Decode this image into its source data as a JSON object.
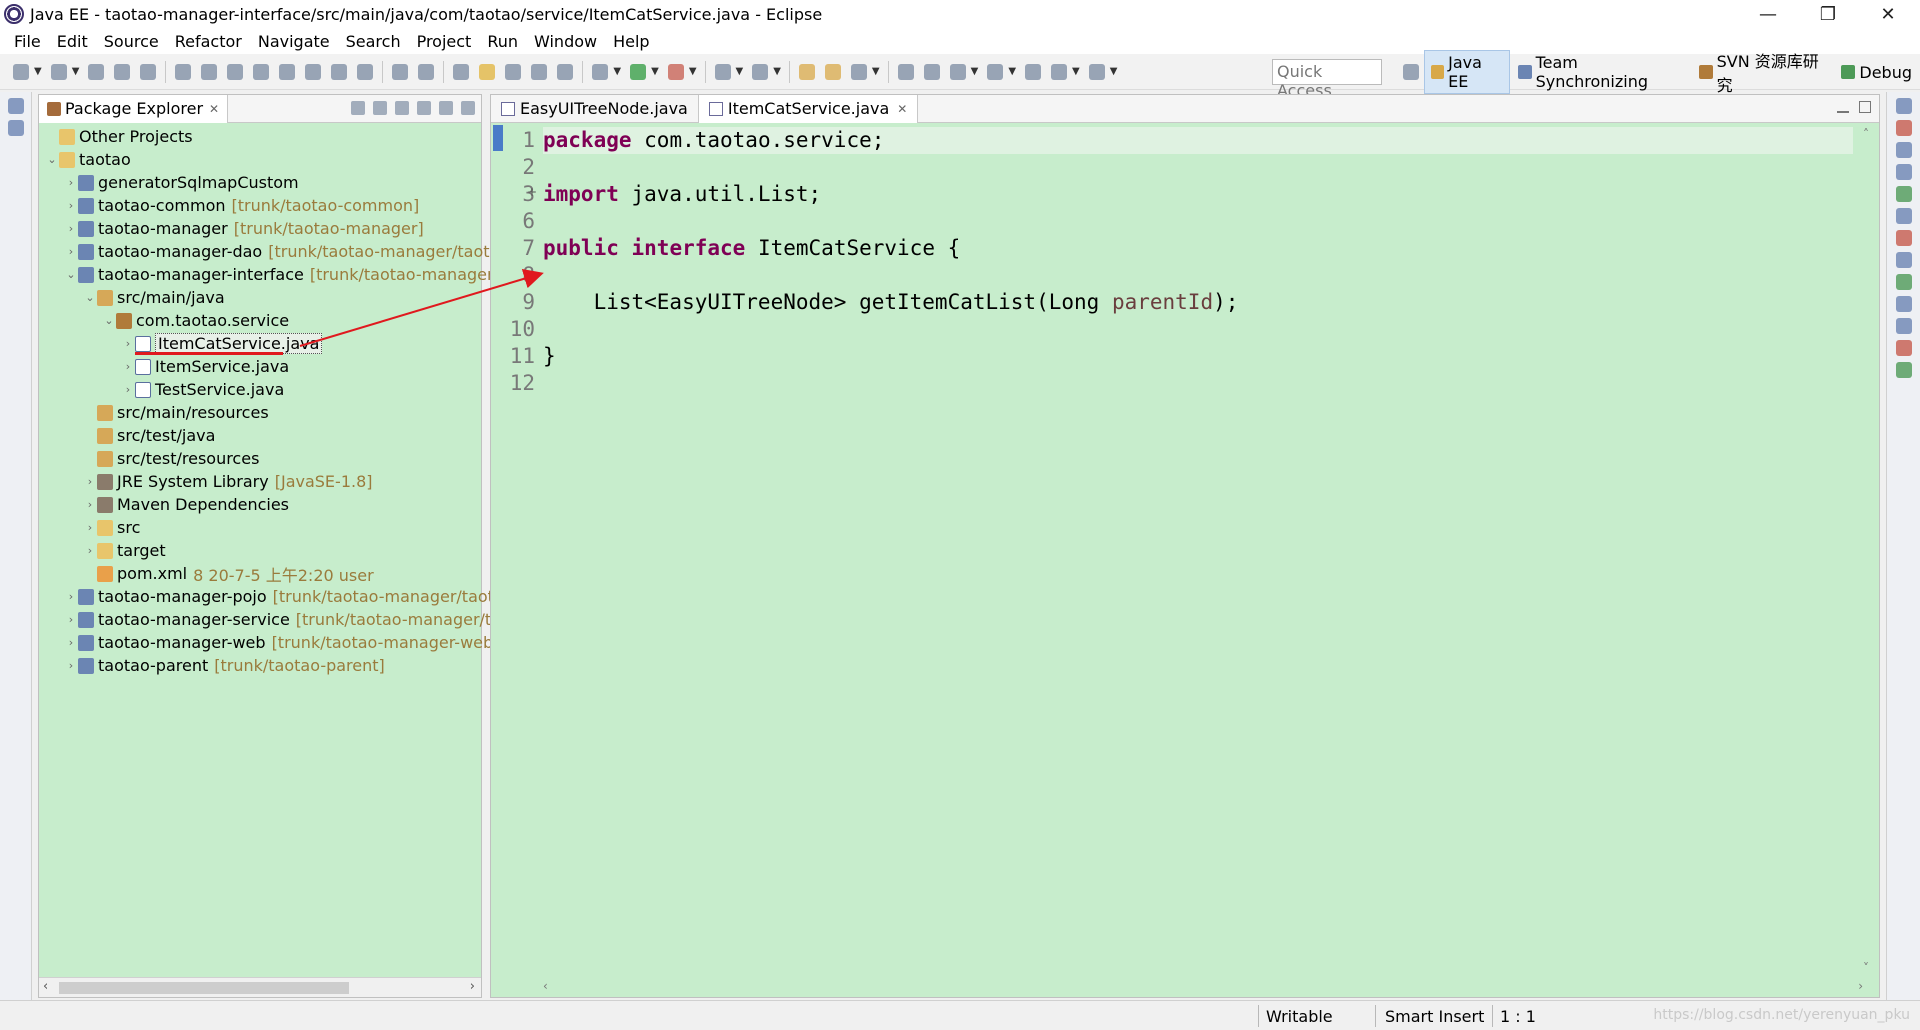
{
  "window": {
    "title": "Java EE - taotao-manager-interface/src/main/java/com/taotao/service/ItemCatService.java - Eclipse",
    "controls": [
      "—",
      "❐",
      "✕"
    ]
  },
  "menu": [
    "File",
    "Edit",
    "Source",
    "Refactor",
    "Navigate",
    "Search",
    "Project",
    "Run",
    "Window",
    "Help"
  ],
  "toolbar": {
    "quick_access": "Quick Access",
    "perspectives": [
      {
        "label": "Java EE",
        "active": true
      },
      {
        "label": "Team Synchronizing",
        "active": false
      },
      {
        "label": "SVN 资源库研究",
        "active": false
      },
      {
        "label": "Debug",
        "active": false
      }
    ]
  },
  "package_explorer": {
    "title": "Package Explorer",
    "close": "✕",
    "tree": [
      {
        "label": "Other Projects",
        "deco": "",
        "level": 0,
        "chev": "",
        "icon": "folder"
      },
      {
        "label": "taotao",
        "deco": "",
        "level": 0,
        "chev": "⌄",
        "icon": "folder"
      },
      {
        "label": "generatorSqlmapCustom",
        "deco": "",
        "level": 1,
        "chev": "›",
        "icon": "project"
      },
      {
        "label": "taotao-common",
        "deco": "[trunk/taotao-common]",
        "level": 1,
        "chev": "›",
        "icon": "project"
      },
      {
        "label": "taotao-manager",
        "deco": "[trunk/taotao-manager]",
        "level": 1,
        "chev": "›",
        "icon": "project"
      },
      {
        "label": "taotao-manager-dao",
        "deco": "[trunk/taotao-manager/taotao-",
        "level": 1,
        "chev": "›",
        "icon": "project"
      },
      {
        "label": "taotao-manager-interface",
        "deco": "[trunk/taotao-manager/ta",
        "level": 1,
        "chev": "⌄",
        "icon": "project"
      },
      {
        "label": "src/main/java",
        "deco": "",
        "level": 2,
        "chev": "⌄",
        "icon": "src"
      },
      {
        "label": "com.taotao.service",
        "deco": "",
        "level": 3,
        "chev": "⌄",
        "icon": "pkg"
      },
      {
        "label": "ItemCatService.java",
        "deco": "",
        "level": 4,
        "chev": "›",
        "icon": "java",
        "selected": true
      },
      {
        "label": "ItemService.java",
        "deco": "",
        "level": 4,
        "chev": "›",
        "icon": "java"
      },
      {
        "label": "TestService.java",
        "deco": "",
        "level": 4,
        "chev": "›",
        "icon": "java"
      },
      {
        "label": "src/main/resources",
        "deco": "",
        "level": 2,
        "chev": "",
        "icon": "src"
      },
      {
        "label": "src/test/java",
        "deco": "",
        "level": 2,
        "chev": "",
        "icon": "src"
      },
      {
        "label": "src/test/resources",
        "deco": "",
        "level": 2,
        "chev": "",
        "icon": "src"
      },
      {
        "label": "JRE System Library",
        "deco": "[JavaSE-1.8]",
        "level": 2,
        "chev": "›",
        "icon": "lib"
      },
      {
        "label": "Maven Dependencies",
        "deco": "",
        "level": 2,
        "chev": "›",
        "icon": "lib"
      },
      {
        "label": "src",
        "deco": "",
        "level": 2,
        "chev": "›",
        "icon": "folder"
      },
      {
        "label": "target",
        "deco": "",
        "level": 2,
        "chev": "›",
        "icon": "folder"
      },
      {
        "label": "pom.xml",
        "deco": "8  20-7-5 上午2:20  user",
        "level": 2,
        "chev": "",
        "icon": "xml"
      },
      {
        "label": "taotao-manager-pojo",
        "deco": "[trunk/taotao-manager/taotao",
        "level": 1,
        "chev": "›",
        "icon": "project"
      },
      {
        "label": "taotao-manager-service",
        "deco": "[trunk/taotao-manager/taot",
        "level": 1,
        "chev": "›",
        "icon": "project"
      },
      {
        "label": "taotao-manager-web",
        "deco": "[trunk/taotao-manager-web]",
        "level": 1,
        "chev": "›",
        "icon": "project"
      },
      {
        "label": "taotao-parent",
        "deco": "[trunk/taotao-parent]",
        "level": 1,
        "chev": "›",
        "icon": "project"
      }
    ]
  },
  "editor": {
    "tabs": [
      {
        "label": "EasyUITreeNode.java",
        "active": false
      },
      {
        "label": "ItemCatService.java",
        "active": true
      }
    ],
    "line_numbers": [
      "1",
      "2",
      "3",
      "6",
      "7",
      "8",
      "9",
      "10",
      "11",
      "12"
    ],
    "lines": [
      [
        {
          "t": "package",
          "k": "kw"
        },
        {
          "t": " com.taotao.service;",
          "k": ""
        }
      ],
      [],
      [
        {
          "t": "import",
          "k": "kw"
        },
        {
          "t": " java.util.List;",
          "k": ""
        }
      ],
      [],
      [
        {
          "t": "public",
          "k": "kw"
        },
        {
          "t": " ",
          "k": ""
        },
        {
          "t": "interface",
          "k": "kw"
        },
        {
          "t": " ItemCatService {",
          "k": ""
        }
      ],
      [],
      [
        {
          "t": "    List<EasyUITreeNode> getItemCatList(Long ",
          "k": ""
        },
        {
          "t": "parentId",
          "k": "param"
        },
        {
          "t": ");",
          "k": ""
        }
      ],
      [],
      [
        {
          "t": "}",
          "k": ""
        }
      ],
      []
    ]
  },
  "status": {
    "writable": "Writable",
    "insert_mode": "Smart Insert",
    "position": "1 : 1",
    "watermark": "https://blog.csdn.net/yerenyuan_pku"
  }
}
